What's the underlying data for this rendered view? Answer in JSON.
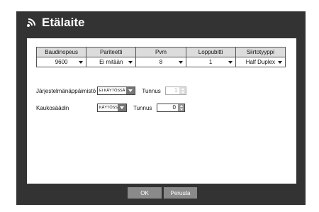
{
  "window": {
    "title": "Etälaite",
    "title_icon": "signal-icon"
  },
  "table": {
    "headers": [
      "Baudinopeus",
      "Pariteetti",
      "Pvm",
      "Loppubitti",
      "Siirtotyyppi"
    ],
    "values": [
      "9600",
      "Ei mitään",
      "8",
      "1",
      "Half Duplex"
    ]
  },
  "settings": {
    "keyboard": {
      "label": "Järjestelmänäppäimistö",
      "select_value": "EI KÄYTÖSSÄ",
      "id_label": "Tunnus",
      "id_value": "1"
    },
    "remote": {
      "label": "Kaukosäädin",
      "select_value": "KÄYTÖSSÄ",
      "id_label": "Tunnus",
      "id_value": "0"
    }
  },
  "buttons": {
    "ok": "OK",
    "cancel": "Peruuta"
  },
  "colors": {
    "frame": "#333333",
    "header_cell": "#dcdcdc",
    "button": "#8a8a8a"
  }
}
